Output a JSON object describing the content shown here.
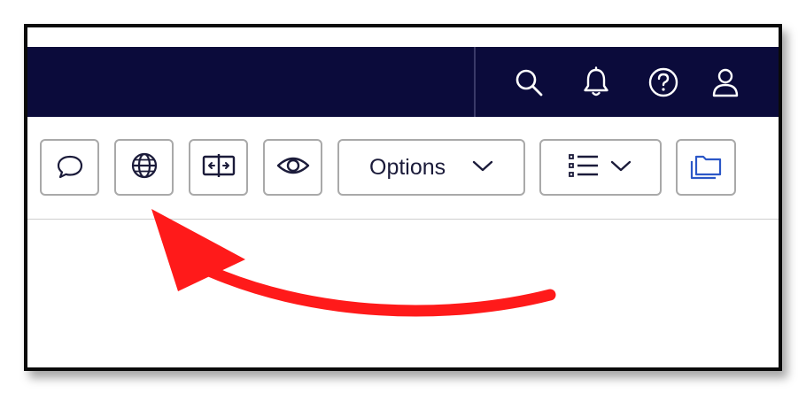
{
  "colors": {
    "topbar_bg": "#0b0b3b",
    "icon_white": "#ffffff",
    "icon_dark": "#1b1b3a",
    "icon_blue": "#2b57c7",
    "button_border": "#a9a9a9",
    "annotation_arrow": "#ff1a1a"
  },
  "topbar": {
    "icons": [
      "search-icon",
      "bell-icon",
      "help-icon",
      "user-icon"
    ]
  },
  "toolbar": {
    "buttons": [
      {
        "icon": "comment-icon"
      },
      {
        "icon": "globe-icon"
      },
      {
        "icon": "resize-icon"
      },
      {
        "icon": "eye-icon"
      },
      {
        "label": "Options",
        "icon": "chevron-down-icon"
      },
      {
        "icon": "list-icon",
        "secondary_icon": "chevron-down-icon"
      },
      {
        "icon": "folders-icon"
      }
    ]
  },
  "annotation": {
    "type": "arrow",
    "points_to": "globe-button"
  }
}
